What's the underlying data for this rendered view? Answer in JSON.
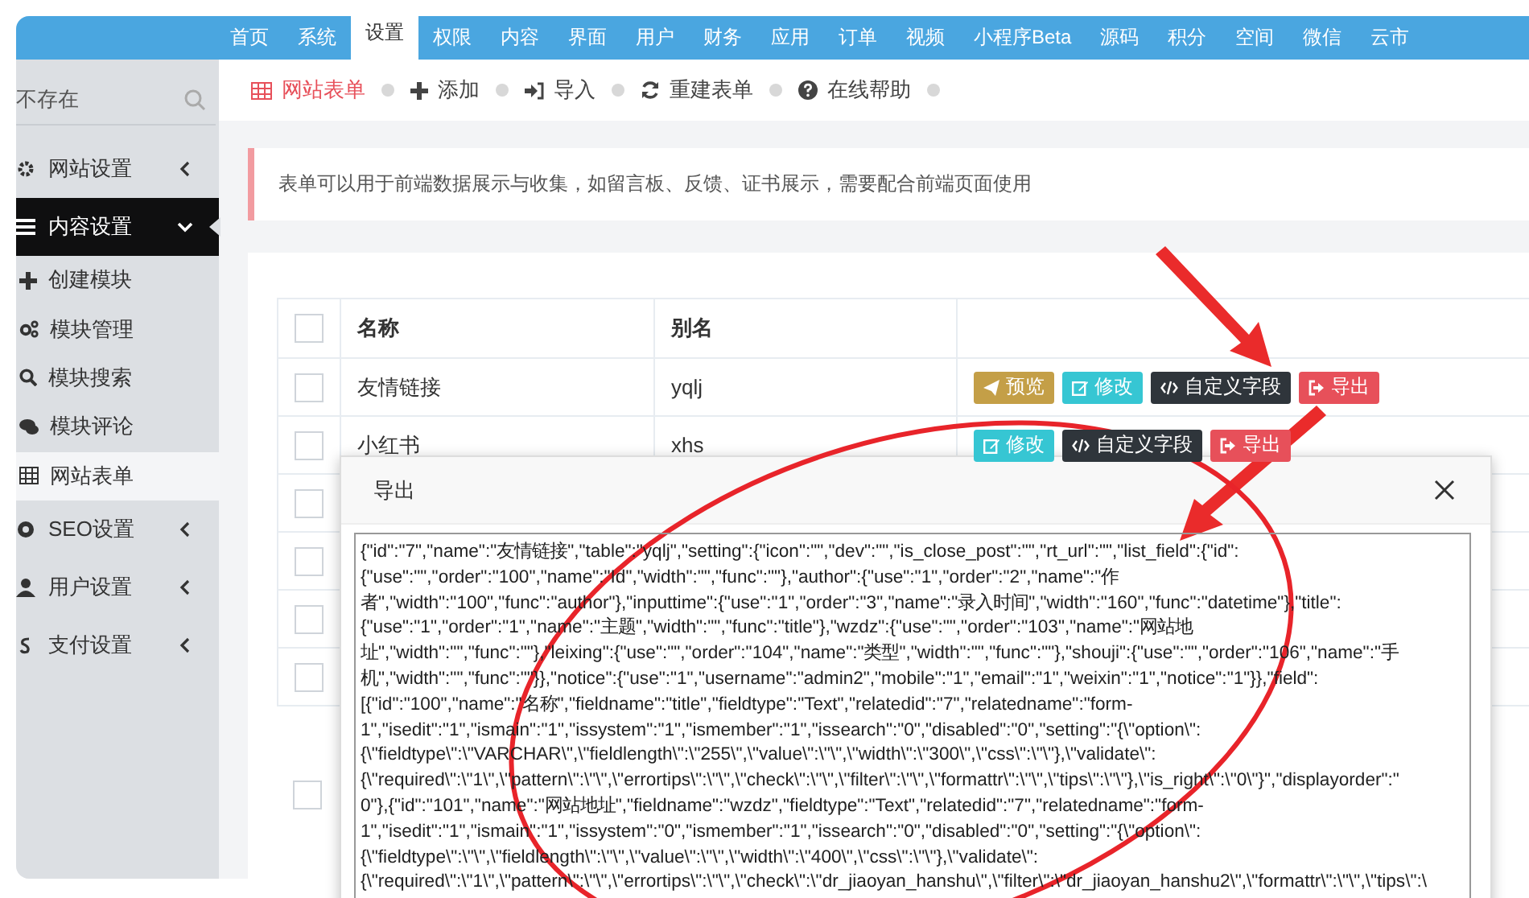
{
  "top_nav": [
    {
      "label": "首页",
      "selected": false
    },
    {
      "label": "系统",
      "selected": false
    },
    {
      "label": "设置",
      "selected": true
    },
    {
      "label": "权限",
      "selected": false
    },
    {
      "label": "内容",
      "selected": false
    },
    {
      "label": "界面",
      "selected": false
    },
    {
      "label": "用户",
      "selected": false
    },
    {
      "label": "财务",
      "selected": false
    },
    {
      "label": "应用",
      "selected": false
    },
    {
      "label": "订单",
      "selected": false
    },
    {
      "label": "视频",
      "selected": false
    },
    {
      "label": "小程序Beta",
      "selected": false
    },
    {
      "label": "源码",
      "selected": false
    },
    {
      "label": "积分",
      "selected": false
    },
    {
      "label": "空间",
      "selected": false
    },
    {
      "label": "微信",
      "selected": false
    },
    {
      "label": "云市",
      "selected": false
    }
  ],
  "sidebar": {
    "search": {
      "placeholder": "不存在"
    },
    "items": [
      {
        "label": "网站设置",
        "selected": false,
        "expanded": false
      },
      {
        "label": "内容设置",
        "selected": true,
        "expanded": true,
        "children": [
          {
            "label": "创建模块",
            "selected": false
          },
          {
            "label": "模块管理",
            "selected": false
          },
          {
            "label": "模块搜索",
            "selected": false
          },
          {
            "label": "模块评论",
            "selected": false
          },
          {
            "label": "网站表单",
            "selected": true
          }
        ]
      },
      {
        "label": "SEO设置",
        "selected": false,
        "expanded": false
      },
      {
        "label": "用户设置",
        "selected": false,
        "expanded": false
      },
      {
        "label": "支付设置",
        "selected": false,
        "expanded": false
      }
    ]
  },
  "toolbar": [
    {
      "label": "网站表单",
      "selected": true
    },
    {
      "label": "添加",
      "selected": false
    },
    {
      "label": "导入",
      "selected": false
    },
    {
      "label": "重建表单",
      "selected": false
    },
    {
      "label": "在线帮助",
      "selected": false
    }
  ],
  "notice": "表单可以用于前端数据展示与收集，如留言板、反馈、证书展示，需要配合前端页面使用",
  "table": {
    "header_checked": false,
    "columns": [
      "名称",
      "别名"
    ],
    "rows": [
      {
        "checked": false,
        "name": "友情链接",
        "alias": "yqlj",
        "actions": [
          {
            "kind": "preview",
            "label": "预览"
          },
          {
            "kind": "edit",
            "label": "修改"
          },
          {
            "kind": "fields",
            "label": "自定义字段"
          },
          {
            "kind": "export",
            "label": "导出"
          }
        ]
      },
      {
        "checked": false,
        "name": "小红书",
        "alias": "xhs",
        "actions": [
          {
            "kind": "edit",
            "label": "修改"
          },
          {
            "kind": "fields",
            "label": "自定义字段"
          },
          {
            "kind": "export",
            "label": "导出"
          }
        ]
      },
      {
        "checked": false
      },
      {
        "checked": false
      },
      {
        "checked": false
      },
      {
        "checked": false
      }
    ],
    "footer_checked": false
  },
  "dialog": {
    "title": "导出",
    "content_lines": [
      "{\"id\":\"7\",\"name\":\"友情链接\",\"table\":\"yqlj\",\"setting\":{\"icon\":\"\",\"dev\":\"\",\"is_close_post\":\"\",\"rt_url\":\"\",\"list_field\":{\"id\":",
      "{\"use\":\"\",\"order\":\"100\",\"name\":\"Id\",\"width\":\"\",\"func\":\"\"},\"author\":{\"use\":\"1\",\"order\":\"2\",\"name\":\"作",
      "者\",\"width\":\"100\",\"func\":\"author\"},\"inputtime\":{\"use\":\"1\",\"order\":\"3\",\"name\":\"录入时间\",\"width\":\"160\",\"func\":\"datetime\"},\"title\":",
      "{\"use\":\"1\",\"order\":\"1\",\"name\":\"主题\",\"width\":\"\",\"func\":\"title\"},\"wzdz\":{\"use\":\"\",\"order\":\"103\",\"name\":\"网站地",
      "址\",\"width\":\"\",\"func\":\"\"},\"leixing\":{\"use\":\"\",\"order\":\"104\",\"name\":\"类型\",\"width\":\"\",\"func\":\"\"},\"shouji\":{\"use\":\"\",\"order\":\"106\",\"name\":\"手",
      "机\",\"width\":\"\",\"func\":\"\"}},\"notice\":{\"use\":\"1\",\"username\":\"admin2\",\"mobile\":\"1\",\"email\":\"1\",\"weixin\":\"1\",\"notice\":\"1\"}},\"field\":",
      "[{\"id\":\"100\",\"name\":\"名称\",\"fieldname\":\"title\",\"fieldtype\":\"Text\",\"relatedid\":\"7\",\"relatedname\":\"form-",
      "1\",\"isedit\":\"1\",\"ismain\":\"1\",\"issystem\":\"1\",\"ismember\":\"1\",\"issearch\":\"0\",\"disabled\":\"0\",\"setting\":\"{\\\"option\\\":",
      "{\\\"fieldtype\\\":\\\"VARCHAR\\\",\\\"fieldlength\\\":\\\"255\\\",\\\"value\\\":\\\"\\\",\\\"width\\\":\\\"300\\\",\\\"css\\\":\\\"\\\"},\\\"validate\\\":",
      "{\\\"required\\\":\\\"1\\\",\\\"pattern\\\":\\\"\\\",\\\"errortips\\\":\\\"\\\",\\\"check\\\":\\\"\\\",\\\"filter\\\":\\\"\\\",\\\"formattr\\\":\\\"\\\",\\\"tips\\\":\\\"\\\"},\\\"is_right\\\":\\\"0\\\"}\",\"displayorder\":\"",
      "0\"},{\"id\":\"101\",\"name\":\"网站地址\",\"fieldname\":\"wzdz\",\"fieldtype\":\"Text\",\"relatedid\":\"7\",\"relatedname\":\"form-",
      "1\",\"isedit\":\"1\",\"ismain\":\"1\",\"issystem\":\"0\",\"ismember\":\"1\",\"issearch\":\"0\",\"disabled\":\"0\",\"setting\":\"{\\\"option\\\":",
      "{\\\"fieldtype\\\":\\\"\\\",\\\"fieldlength\\\":\\\"\\\",\\\"value\\\":\\\"\\\",\\\"width\\\":\\\"400\\\",\\\"css\\\":\\\"\\\"},\\\"validate\\\":",
      "{\\\"required\\\":\\\"1\\\",\\\"pattern\\\":\\\"\\\",\\\"errortips\\\":\\\"\\\",\\\"check\\\":\\\"dr_jiaoyan_hanshu\\\",\\\"filter\\\":\\\"dr_jiaoyan_hanshu2\\\",\\\"formattr\\\":\\\"\\\",\\\"tips\\\":\\"
    ]
  }
}
